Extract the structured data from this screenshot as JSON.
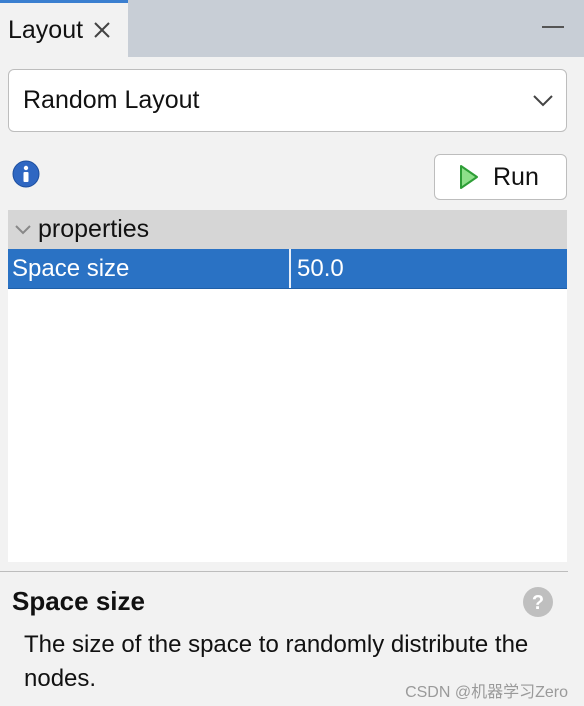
{
  "tab": {
    "title": "Layout"
  },
  "layout_select": {
    "value": "Random Layout"
  },
  "toolbar": {
    "run_label": "Run"
  },
  "properties": {
    "group_label": "properties",
    "rows": [
      {
        "name": "Space size",
        "value": "50.0"
      }
    ]
  },
  "description": {
    "title": "Space size",
    "text": "The size of the space to randomly distribute the nodes."
  },
  "watermark": "CSDN @机器学习Zero",
  "colors": {
    "accent": "#2a72c4",
    "tab_indicator": "#3b7fd0",
    "play_green": "#3cb043"
  },
  "icons": {
    "close": "close-icon",
    "minimize": "minimize-icon",
    "dropdown": "chevron-down-icon",
    "info": "info-icon",
    "run": "play-icon",
    "group_toggle": "chevron-down-icon",
    "help": "help-icon"
  }
}
